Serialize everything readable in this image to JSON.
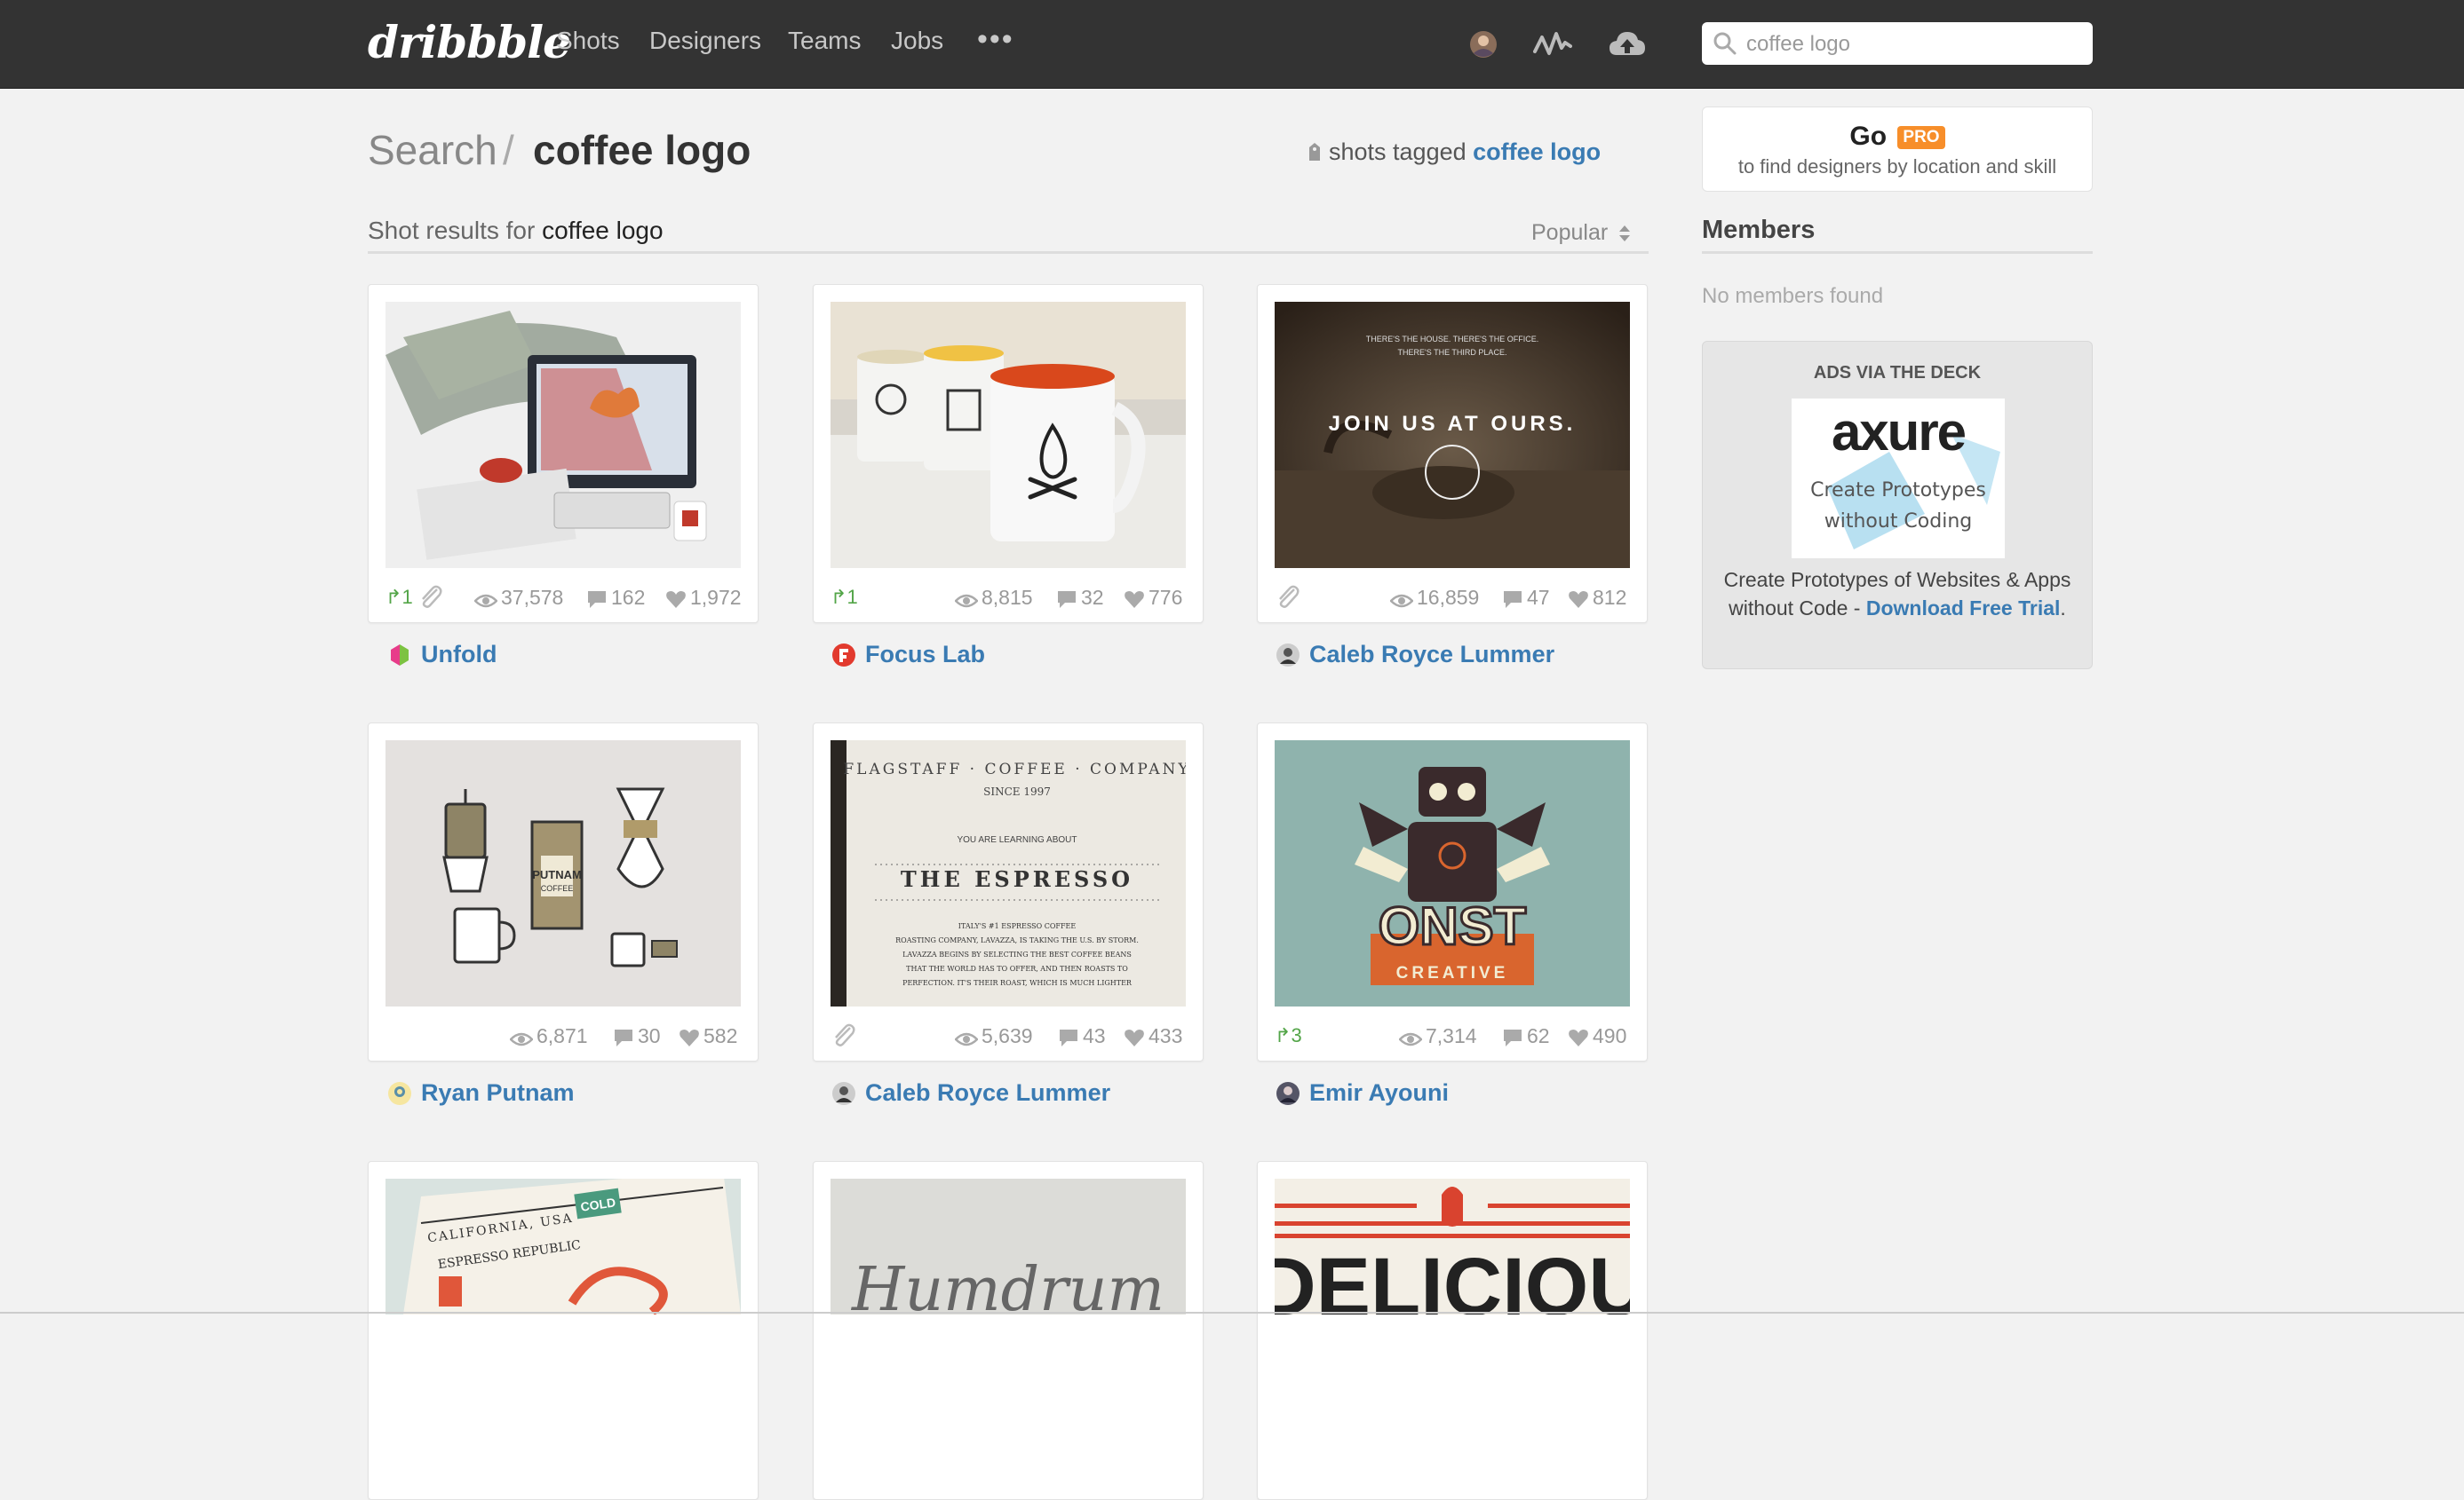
{
  "nav": {
    "logo": "dribbble",
    "items": [
      "Shots",
      "Designers",
      "Teams",
      "Jobs"
    ],
    "more": "•••",
    "search_value": "coffee logo"
  },
  "heading": {
    "search": "Search",
    "separator": "/",
    "term": "coffee logo",
    "tagged_prefix": "shots tagged",
    "tagged_link": "coffee logo"
  },
  "results": {
    "prefix": "Shot results for",
    "term": "coffee logo",
    "sort": "Popular"
  },
  "shots": [
    {
      "rebounds": "1",
      "attachment": true,
      "views": "37,578",
      "comments": "162",
      "likes": "1,972",
      "player": "Unfold",
      "icon": "photo-collage-illustration"
    },
    {
      "rebounds": "1",
      "attachment": false,
      "views": "8,815",
      "comments": "32",
      "likes": "776",
      "player": "Focus Lab",
      "icon": "campfire-mug-photo"
    },
    {
      "rebounds": "",
      "attachment": true,
      "views": "16,859",
      "comments": "47",
      "likes": "812",
      "player": "Caleb Royce Lummer",
      "icon": "coffee-poster-photo"
    },
    {
      "rebounds": "",
      "attachment": false,
      "views": "6,871",
      "comments": "30",
      "likes": "582",
      "player": "Ryan Putnam",
      "icon": "coffee-gear-illustration"
    },
    {
      "rebounds": "",
      "attachment": true,
      "views": "5,639",
      "comments": "43",
      "likes": "433",
      "player": "Caleb Royce Lummer",
      "icon": "espresso-letterpress"
    },
    {
      "rebounds": "3",
      "attachment": false,
      "views": "7,314",
      "comments": "62",
      "likes": "490",
      "player": "Emir Ayouni",
      "icon": "robot-logo"
    },
    {
      "player": "",
      "icon": "coffee-label-photo"
    },
    {
      "player": "",
      "icon": "humdrum-script"
    },
    {
      "player": "",
      "icon": "delicious-poster"
    }
  ],
  "shot_texts": {
    "poster3_line1": "THERE'S THE HOUSE. THERE'S THE OFFICE.",
    "poster3_line2": "THERE'S THE THIRD PLACE.",
    "poster3_headline": "JOIN US AT OURS.",
    "gear_bag": "PUTNAM",
    "gear_bag2": "COFFEE",
    "espresso_arc": "FLAGSTAFF · COFFEE · COMPANY",
    "espresso_since": "SINCE 1997",
    "espresso_learning": "YOU ARE LEARNING ABOUT",
    "espresso_title": "THE ESPRESSO",
    "espresso_body1": "ITALY'S #1 ESPRESSO COFFEE",
    "espresso_body2": "ROASTING COMPANY, LAVAZZA, IS TAKING THE U.S. BY STORM.",
    "espresso_body3": "LAVAZZA BEGINS BY SELECTING THE BEST COFFEE BEANS",
    "espresso_body4": "THAT THE WORLD HAS TO OFFER, AND THEN ROASTS TO",
    "espresso_body5": "PERFECTION. IT'S THEIR ROAST, WHICH IS MUCH LIGHTER",
    "robot_brand": "ONST",
    "robot_sub": "CREATIVE",
    "label_top": "CALIFORNIA, USA",
    "label_cold": "COLD",
    "label_brand": "ESPRESSO REPUBLIC",
    "humdrum": "Humdrum",
    "delicious": "DELICIOU"
  },
  "sidebar": {
    "go": "Go",
    "pro": "PRO",
    "go_sub": "to find designers by location and skill",
    "members_title": "Members",
    "no_members": "No members found",
    "ads_title": "ADS VIA THE DECK",
    "ad_logo": "axure",
    "ad_tagline1": "Create Prototypes",
    "ad_tagline2": "without Coding",
    "ad_copy": "Create Prototypes of Websites & Apps without Code - ",
    "ad_link": "Download Free Trial",
    "ad_period": "."
  },
  "colors": {
    "topbar": "#333333",
    "link": "#3a7bb3",
    "rebound": "#53a548",
    "pro_badge": "#f78e2a"
  }
}
